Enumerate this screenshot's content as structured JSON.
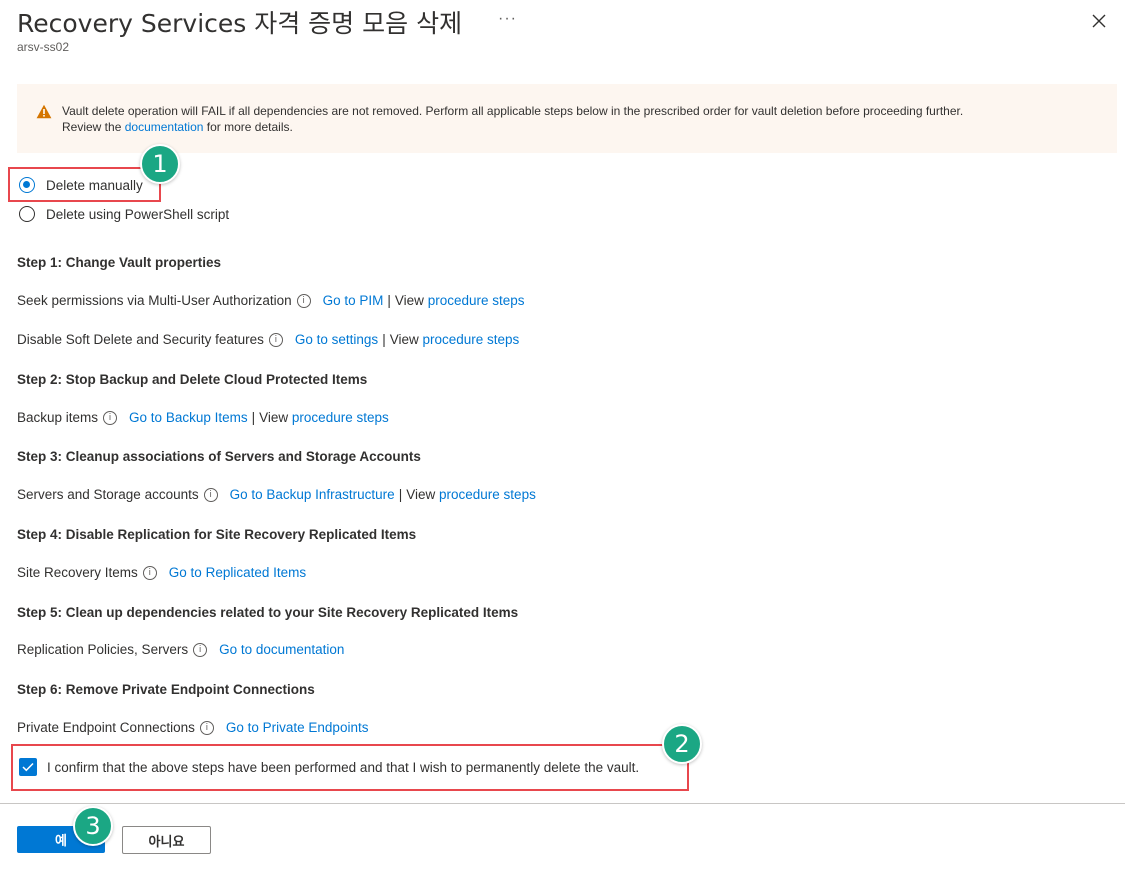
{
  "header": {
    "title": "Recovery Services 자격 증명 모음 삭제",
    "more_label": "···",
    "subtitle": "arsv-ss02",
    "close_icon": "close-icon"
  },
  "banner": {
    "icon": "warning-icon",
    "color": "#fdf6f0",
    "text_before": "Vault delete operation will FAIL if all dependencies are not removed. Perform all applicable steps below in the prescribed order for vault deletion before proceeding further.",
    "review_prefix": "Review the",
    "link": "documentation",
    "text_after": "for more details."
  },
  "options": [
    {
      "label": "Delete manually",
      "selected": true
    },
    {
      "label": "Delete using PowerShell script",
      "selected": false
    }
  ],
  "steps": {
    "step1_title": "Step 1: Change Vault properties",
    "mua_label": "Seek permissions via Multi-User Authorization",
    "mua_link": "Go to PIM",
    "mua_view": "View",
    "mua_proc": "procedure steps",
    "soft_label": "Disable Soft Delete and Security features",
    "soft_link": "Go to settings",
    "soft_view": "View",
    "soft_proc": "procedure steps",
    "step2_title": "Step 2: Stop Backup and Delete Cloud Protected Items",
    "backup_label": "Backup items",
    "backup_link": "Go to Backup Items",
    "backup_view": "View",
    "backup_proc": "procedure steps",
    "step3_title": "Step 3: Cleanup associations of Servers and Storage Accounts",
    "servers_label": "Servers and Storage accounts",
    "servers_link": "Go to Backup Infrastructure",
    "servers_view": "View",
    "servers_proc": "procedure steps",
    "step4_title": "Step 4: Disable Replication for Site Recovery Replicated Items",
    "sr_label": "Site Recovery Items",
    "sr_link": "Go to Replicated Items",
    "step5_title": "Step 5: Clean up dependencies related to your Site Recovery Replicated Items",
    "rp_label": "Replication Policies, Servers",
    "rp_link": "Go to documentation",
    "step6_title": "Step 6: Remove Private Endpoint Connections",
    "pe_label": "Private Endpoint Connections",
    "pe_link": "Go to Private Endpoints",
    "separator": "|"
  },
  "confirm": {
    "checked": true,
    "label": "I confirm that the above steps have been performed and that I wish to permanently delete the vault."
  },
  "footer": {
    "yes_label": "예",
    "no_label": "아니요"
  },
  "annotations": {
    "badge1": "1",
    "badge2": "2",
    "badge3": "3",
    "badge_color": "#1ba784",
    "box_color": "#e8474d"
  }
}
